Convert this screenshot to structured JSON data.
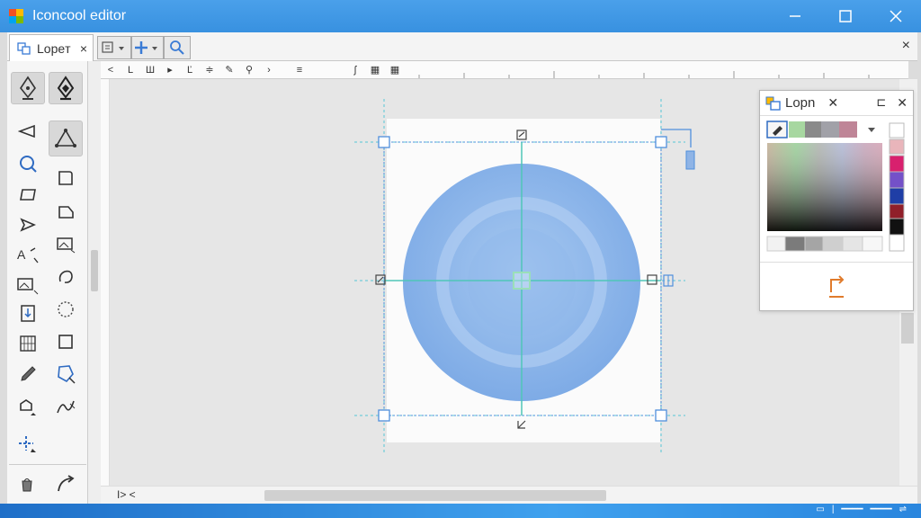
{
  "window": {
    "title": "Iconcool editor",
    "controls": [
      "minimize",
      "maximize",
      "close"
    ]
  },
  "doc_tab": {
    "label": "Lopeт",
    "close": "×"
  },
  "panel_close": "×",
  "toolbar_icons": [
    "select-dropdown-icon",
    "move-tool-icon",
    "zoom-icon"
  ],
  "toolbox": {
    "tools": [
      "pen-icon",
      "pen-filled-icon",
      "megaphone-icon",
      "triangle-node-icon",
      "magnifier-icon",
      "rounded-rect-icon",
      "rect-icon",
      "tag-shape-icon",
      "arrow-select-icon",
      "image-frame-icon",
      "text-tool-icon",
      "lasso-icon",
      "image-resize-icon",
      "ellipse-dashed-icon",
      "import-icon",
      "square-icon",
      "grid-icon",
      "polygon-select-icon",
      "eyedropper-icon",
      "transform-icon",
      "shape-dropdown-icon",
      "path-icon",
      "crosshair-icon",
      "bucket-icon",
      "curve-arrow-icon"
    ]
  },
  "ruler_tools": [
    "<",
    "L",
    "Ш",
    "▸",
    "Ľ",
    "≑",
    "✎",
    "⚲",
    "›",
    "≡",
    "ʃ",
    "▦",
    "▦"
  ],
  "color_panel": {
    "title": "Lopn",
    "swatches": [
      "#a7d7a0",
      "#8a8a8a",
      "#a1a1a8",
      "#bf8597"
    ],
    "palette": [
      "#ffffff",
      "#e9b5bb",
      "#d8206e",
      "#7451c8",
      "#1f3ea6",
      "#901f2a",
      "#111111",
      "#ffffff"
    ],
    "grays": [
      "#f2f2f2",
      "#7b7b7b",
      "#a5a5a5",
      "#cfcfcf",
      "#e5e5e5",
      "#f7f7f7"
    ]
  },
  "statusbar": {
    "zoom_label": "I> <"
  },
  "colors": {
    "accent": "#3891e0",
    "circle": "#8ab4e8",
    "guide": "#57c7d6"
  }
}
